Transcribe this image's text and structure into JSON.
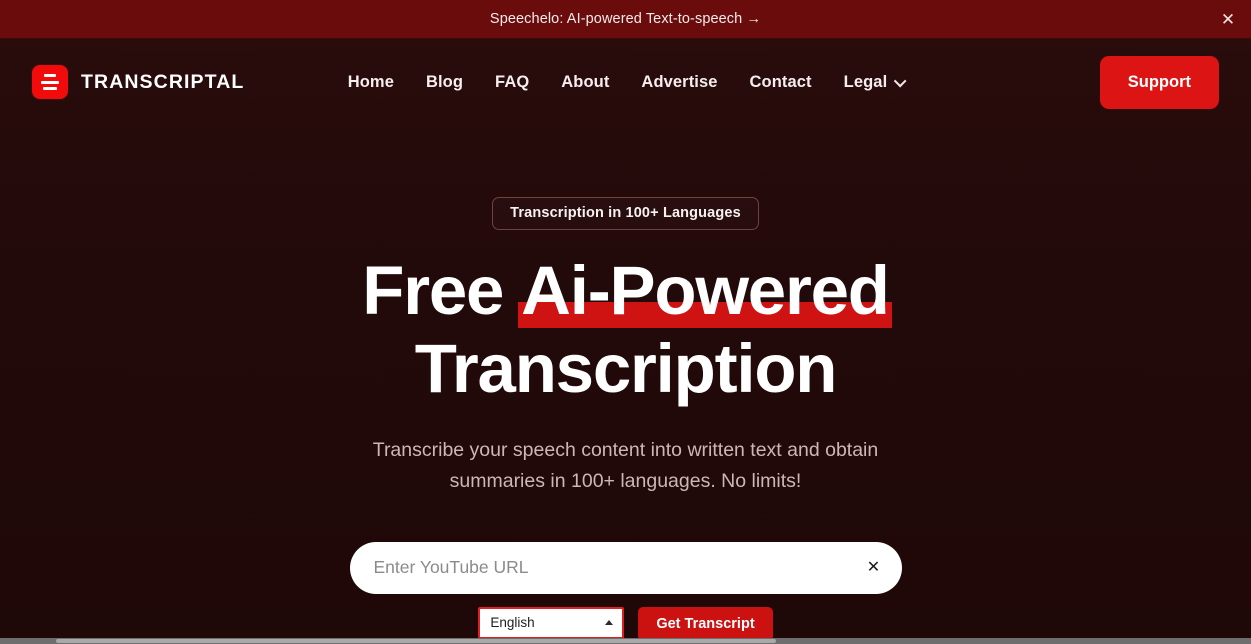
{
  "theme": {
    "page_bg": "#230a0a",
    "banner_bg": "#6b0c0c",
    "accent_red": "#dc1414",
    "highlight_red": "#cf1313",
    "button_red": "#cc1111",
    "focus_border": "#e02020",
    "text_white": "#ffffff",
    "text_muted": "#cdb6b6"
  },
  "promo_banner": {
    "text": "Speechelo: AI-powered Text-to-speech →",
    "close_icon": "close-icon",
    "close_glyph": "✕"
  },
  "header": {
    "brand": {
      "name": "TRANSCRIPTAL",
      "logo_icon": "transcriptal-logo-icon"
    },
    "nav": [
      {
        "label": "Home"
      },
      {
        "label": "Blog"
      },
      {
        "label": "FAQ"
      },
      {
        "label": "About"
      },
      {
        "label": "Advertise"
      },
      {
        "label": "Contact"
      },
      {
        "label": "Legal",
        "icon": "chevron-down-icon",
        "has_dropdown": true
      }
    ],
    "support_button": "Support"
  },
  "hero": {
    "badge": "Transcription in 100+ Languages",
    "title_line1_plain": "Free ",
    "title_line1_highlight": "Ai-Powered",
    "title_line2": "Transcription",
    "subtitle": "Transcribe your speech content into written text and obtain summaries in 100+ languages. No limits!"
  },
  "search": {
    "placeholder": "Enter YouTube URL",
    "value": "",
    "clear_icon": "close-icon",
    "clear_glyph": "✕",
    "language_selected": "English",
    "language_options": [
      "English"
    ],
    "submit_button": "Get Transcript"
  }
}
